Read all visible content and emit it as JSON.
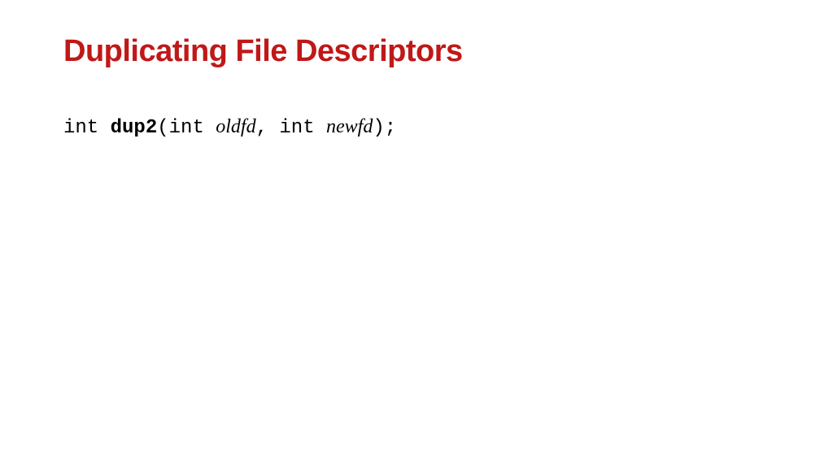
{
  "title": "Duplicating File Descriptors",
  "signature": {
    "return_type": "int",
    "space1": " ",
    "func_name": "dup2",
    "open_paren": "(",
    "param1_type": "int ",
    "param1_name": "oldfd",
    "comma": ", ",
    "param2_type": "int ",
    "param2_name": "newfd",
    "close": ");"
  }
}
